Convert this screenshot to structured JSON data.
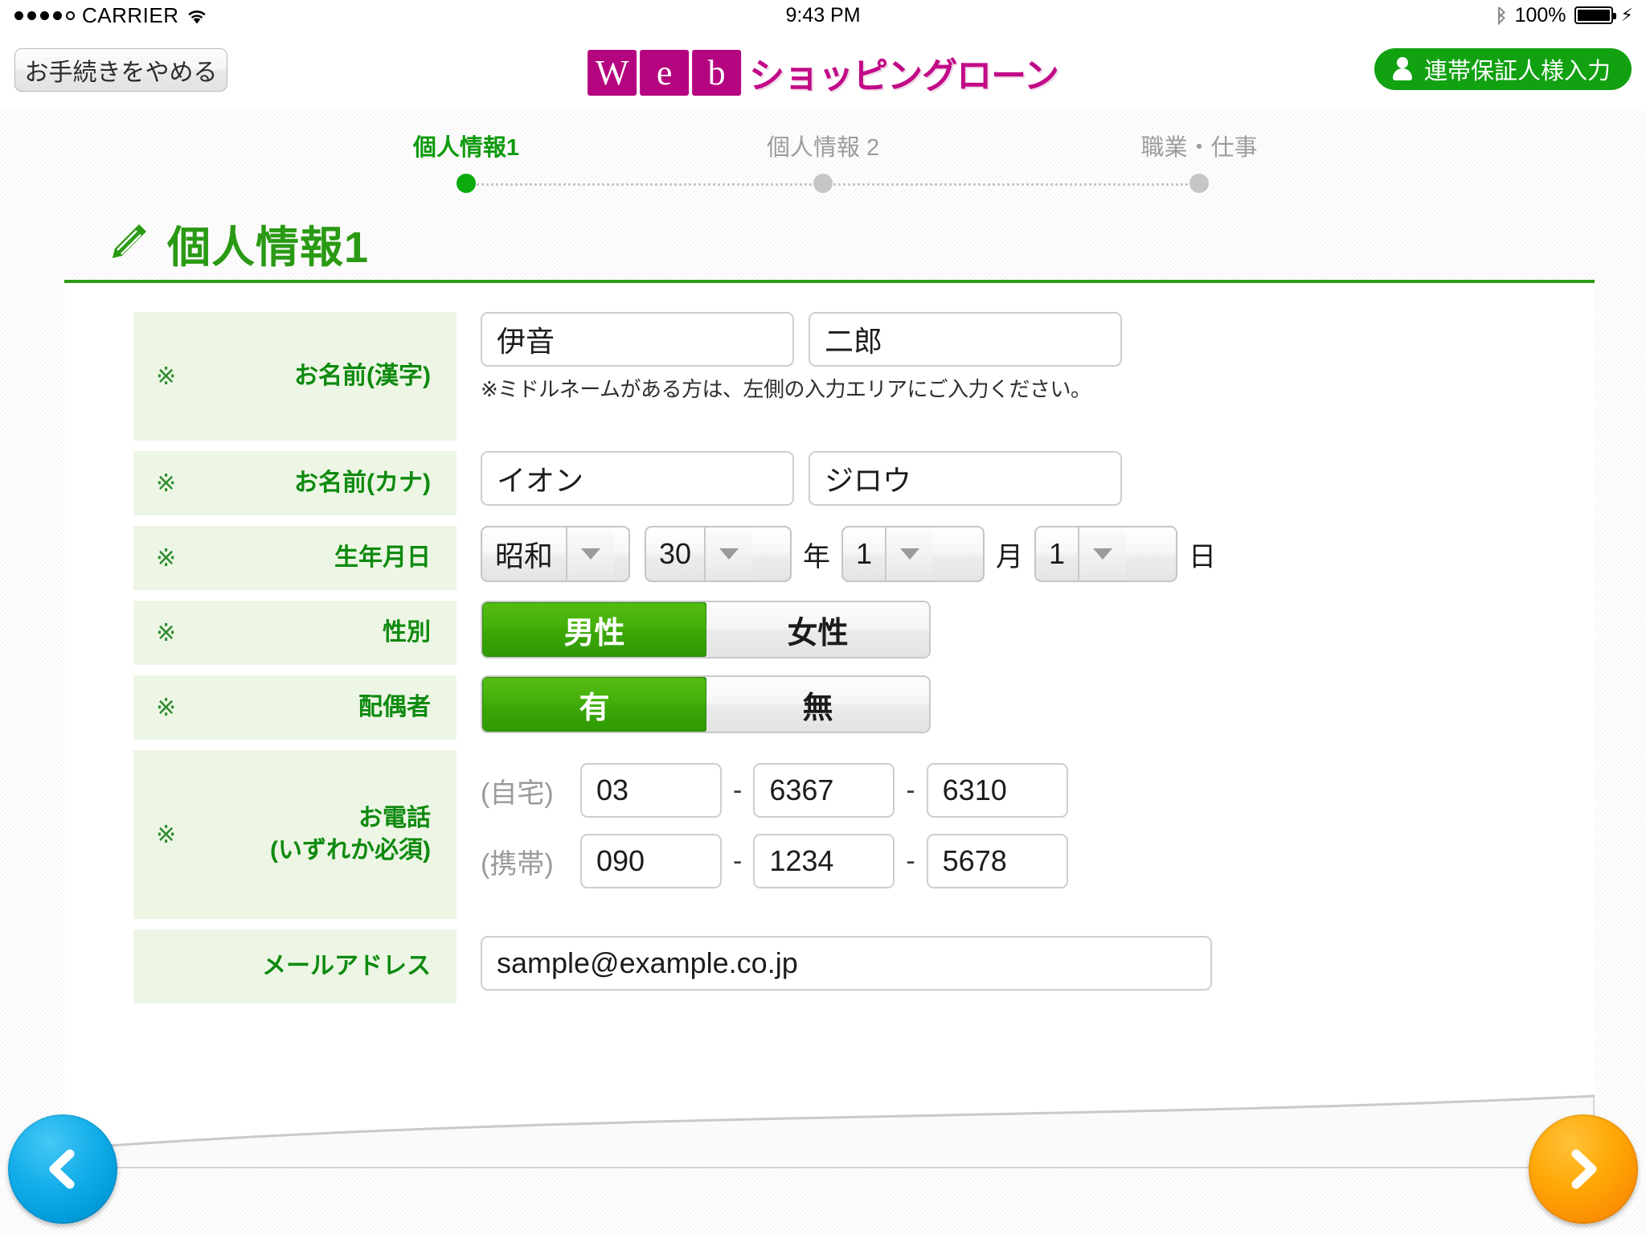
{
  "statusbar": {
    "carrier": "CARRIER",
    "signal_dots_filled": 4,
    "signal_dots_total": 5,
    "wifi_icon": "wifi-icon",
    "time": "9:43 PM",
    "bluetooth_icon": "bluetooth-icon",
    "battery_percent": "100%",
    "battery_icon": "battery-full-icon",
    "charging_icon": "lightning-bolt-icon"
  },
  "header": {
    "quit_label": "お手続きをやめる",
    "logo": {
      "boxes": [
        "W",
        "e",
        "b"
      ],
      "text": "ショッピングローン",
      "box_color": "#b5047f",
      "text_color": "#c20a87"
    },
    "guarantor_label": "連帯保証人様入力",
    "guarantor_icon": "person-icon",
    "guarantor_color": "#11a111"
  },
  "steps": {
    "items": [
      {
        "label": "個人情報1",
        "state": "active"
      },
      {
        "label": "個人情報 2",
        "state": "inactive"
      },
      {
        "label": "職業・仕事",
        "state": "inactive"
      }
    ],
    "active_color": "#0cab0c",
    "inactive_color": "#c6c6c6"
  },
  "section": {
    "icon": "pencil-icon",
    "title": "個人情報1",
    "accent_color": "#2d9d16"
  },
  "form": {
    "rows": [
      {
        "id": "name-kanji",
        "required_mark": "※",
        "label": "お名前(漢字)",
        "inputs": [
          {
            "name": "last-name-kanji-input",
            "value": "伊音",
            "placeholder": ""
          },
          {
            "name": "first-name-kanji-input",
            "value": "二郎",
            "placeholder": ""
          }
        ],
        "note": "※ミドルネームがある方は、左側の入力エリアにご入力ください。"
      },
      {
        "id": "name-kana",
        "required_mark": "※",
        "label": "お名前(カナ)",
        "inputs": [
          {
            "name": "last-name-kana-input",
            "value": "イオン",
            "placeholder": ""
          },
          {
            "name": "first-name-kana-input",
            "value": "ジロウ",
            "placeholder": ""
          }
        ]
      },
      {
        "id": "dob",
        "required_mark": "※",
        "label": "生年月日",
        "selects": [
          {
            "name": "era-select",
            "value": "昭和"
          },
          {
            "name": "year-select",
            "value": "30",
            "unit": "年"
          },
          {
            "name": "month-select",
            "value": "1",
            "unit": "月"
          },
          {
            "name": "day-select",
            "value": "1",
            "unit": "日"
          }
        ]
      },
      {
        "id": "gender",
        "required_mark": "※",
        "label": "性別",
        "options": [
          {
            "name": "gender-male-option",
            "label": "男性",
            "selected": true
          },
          {
            "name": "gender-female-option",
            "label": "女性",
            "selected": false
          }
        ]
      },
      {
        "id": "spouse",
        "required_mark": "※",
        "label": "配偶者",
        "options": [
          {
            "name": "spouse-yes-option",
            "label": "有",
            "selected": true
          },
          {
            "name": "spouse-no-option",
            "label": "無",
            "selected": false
          }
        ]
      },
      {
        "id": "phone",
        "required_mark": "※",
        "label_line1": "お電話",
        "label_line2": "(いずれか必須)",
        "lines": [
          {
            "kind": "(自宅)",
            "separator": "-",
            "parts": [
              {
                "name": "home-phone-part1-input",
                "value": "03"
              },
              {
                "name": "home-phone-part2-input",
                "value": "6367"
              },
              {
                "name": "home-phone-part3-input",
                "value": "6310"
              }
            ]
          },
          {
            "kind": "(携帯)",
            "separator": "-",
            "parts": [
              {
                "name": "mobile-phone-part1-input",
                "value": "090"
              },
              {
                "name": "mobile-phone-part2-input",
                "value": "1234"
              },
              {
                "name": "mobile-phone-part3-input",
                "value": "5678"
              }
            ]
          }
        ]
      },
      {
        "id": "email",
        "required_mark": "",
        "label": "メールアドレス",
        "inputs": [
          {
            "name": "email-input",
            "value": "sample@example.co.jp",
            "placeholder": ""
          }
        ]
      }
    ]
  },
  "nav": {
    "prev_icon": "chevron-left-icon",
    "prev_color": "#029ddb",
    "next_icon": "chevron-right-icon",
    "next_color": "#fb9203"
  }
}
